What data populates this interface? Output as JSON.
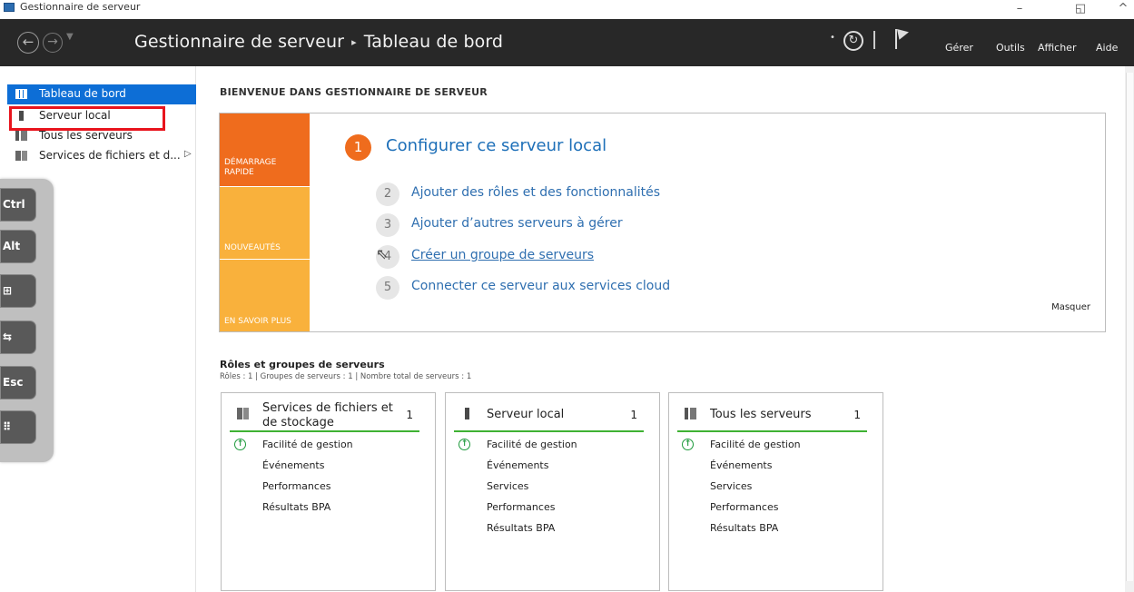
{
  "window": {
    "title": "Gestionnaire de serveur",
    "controls": [
      "–",
      "◱",
      "^"
    ]
  },
  "header": {
    "breadcrumb_root": "Gestionnaire de serveur",
    "breadcrumb_sep": "▸",
    "breadcrumb_page": "Tableau de bord",
    "menus": [
      "Gérer",
      "Outils",
      "Afficher",
      "Aide"
    ]
  },
  "sidebar": {
    "items": [
      {
        "label": "Tableau de bord",
        "icon": "dashboard-icon",
        "active": true
      },
      {
        "label": "Serveur local",
        "icon": "server-icon"
      },
      {
        "label": "Tous les serveurs",
        "icon": "servers-icon"
      },
      {
        "label": "Services de fichiers et d...",
        "icon": "file-services-icon",
        "arrow": "▷"
      }
    ]
  },
  "keypanel": {
    "keys": [
      "Ctrl",
      "Alt",
      "⊞",
      "⇆",
      "Esc",
      "⠿"
    ]
  },
  "welcome": {
    "title": "BIENVENUE DANS GESTIONNAIRE DE SERVEUR",
    "blocks": [
      "DÉMARRAGE RAPIDE",
      "NOUVEAUTÉS",
      "EN SAVOIR PLUS"
    ],
    "main_step": {
      "num": "1",
      "text": "Configurer ce serveur local"
    },
    "steps": [
      {
        "num": "2",
        "text": "Ajouter des rôles et des fonctionnalités"
      },
      {
        "num": "3",
        "text": "Ajouter d’autres serveurs à gérer"
      },
      {
        "num": "4",
        "text": "Créer un groupe de serveurs"
      },
      {
        "num": "5",
        "text": "Connecter ce serveur aux services cloud"
      }
    ],
    "hide": "Masquer"
  },
  "roles": {
    "title": "Rôles et groupes de serveurs",
    "summary": "Rôles : 1   |   Groupes de serveurs : 1   |   Nombre total de serveurs : 1",
    "cards": [
      {
        "title": "Services de fichiers et de stockage",
        "count": "1",
        "rows": [
          "Facilité de gestion",
          "Événements",
          "Performances",
          "Résultats BPA"
        ]
      },
      {
        "title": "Serveur local",
        "count": "1",
        "rows": [
          "Facilité de gestion",
          "Événements",
          "Services",
          "Performances",
          "Résultats BPA"
        ]
      },
      {
        "title": "Tous les serveurs",
        "count": "1",
        "rows": [
          "Facilité de gestion",
          "Événements",
          "Services",
          "Performances",
          "Résultats BPA"
        ]
      }
    ]
  },
  "colors": {
    "header_bg": "#282828",
    "accent_blue": "#0d6ed6",
    "quickstart_orange": "#ef6c1d",
    "quickstart_yellow": "#f9b13c",
    "status_green": "#3fb233",
    "highlight_red": "#e8141d"
  }
}
